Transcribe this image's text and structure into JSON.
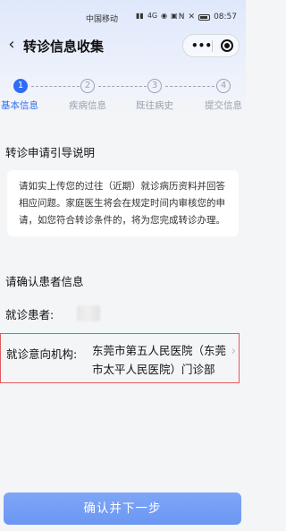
{
  "status_bar": {
    "carrier": "中国移动",
    "signal_text": "4G",
    "time": "08:57"
  },
  "nav": {
    "title": "转诊信息收集",
    "more_glyph": "•••"
  },
  "steps": [
    {
      "number": "1",
      "label": "基本信息",
      "state": "active"
    },
    {
      "number": "2",
      "label": "疾病信息",
      "state": "todo"
    },
    {
      "number": "3",
      "label": "既往病史",
      "state": "todo"
    },
    {
      "number": "4",
      "label": "提交信息",
      "state": "todo"
    }
  ],
  "guide": {
    "title": "转诊申请引导说明",
    "text": "请如实上传您的过往（近期）就诊病历资料并回答相应问题。家庭医生将会在规定时间内审核您的申请，如您符合转诊条件的，将为您完成转诊办理。"
  },
  "confirm_info": {
    "title": "请确认患者信息",
    "patient_label": "就诊患者:",
    "institution_label": "就诊意向机构:",
    "institution_value": "东莞市第五人民医院（东莞市太平人民医院）门诊部"
  },
  "footer": {
    "confirm_button": "确认并下一步"
  },
  "colors": {
    "accent": "#2f6df6",
    "button": "#7fa6f6",
    "highlight_border": "#e25b5b"
  }
}
